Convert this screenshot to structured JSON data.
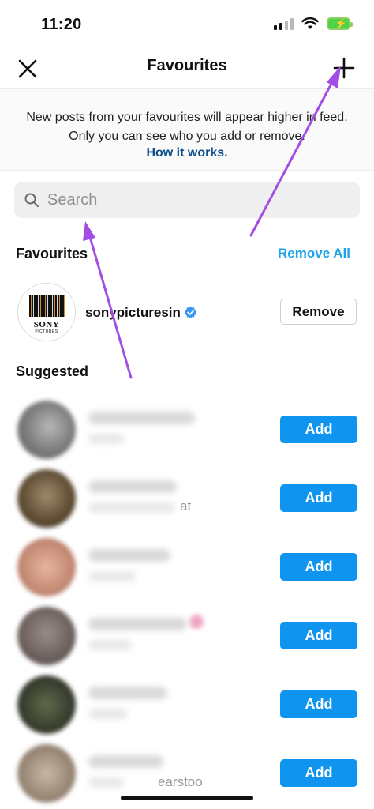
{
  "status_bar": {
    "time": "11:20"
  },
  "header": {
    "title": "Favourites",
    "close_icon": "close-icon",
    "add_icon": "plus-icon"
  },
  "info": {
    "text": "New posts from your favourites will appear higher in feed. Only you can see who you add or remove.",
    "link": "How it works."
  },
  "search": {
    "placeholder": "Search",
    "icon": "search-icon"
  },
  "favourites_section": {
    "title": "Favourites",
    "remove_all_label": "Remove All",
    "items": [
      {
        "username": "sonypicturesin",
        "verified": true,
        "action_label": "Remove",
        "logo_text": "SONY",
        "logo_subtext": "PICTURES"
      }
    ]
  },
  "suggested_section": {
    "title": "Suggested",
    "items": [
      {
        "action_label": "Add",
        "partial_text": ""
      },
      {
        "action_label": "Add",
        "partial_text": "at"
      },
      {
        "action_label": "Add",
        "partial_text": ""
      },
      {
        "action_label": "Add",
        "partial_text": ""
      },
      {
        "action_label": "Add",
        "partial_text": ""
      },
      {
        "action_label": "Add",
        "partial_text": "earstoo"
      }
    ]
  },
  "colors": {
    "accent": "#0f95f0",
    "link": "#1aa3e8",
    "annotation_arrow": "#a24de6",
    "verified_badge": "#3897f0"
  }
}
